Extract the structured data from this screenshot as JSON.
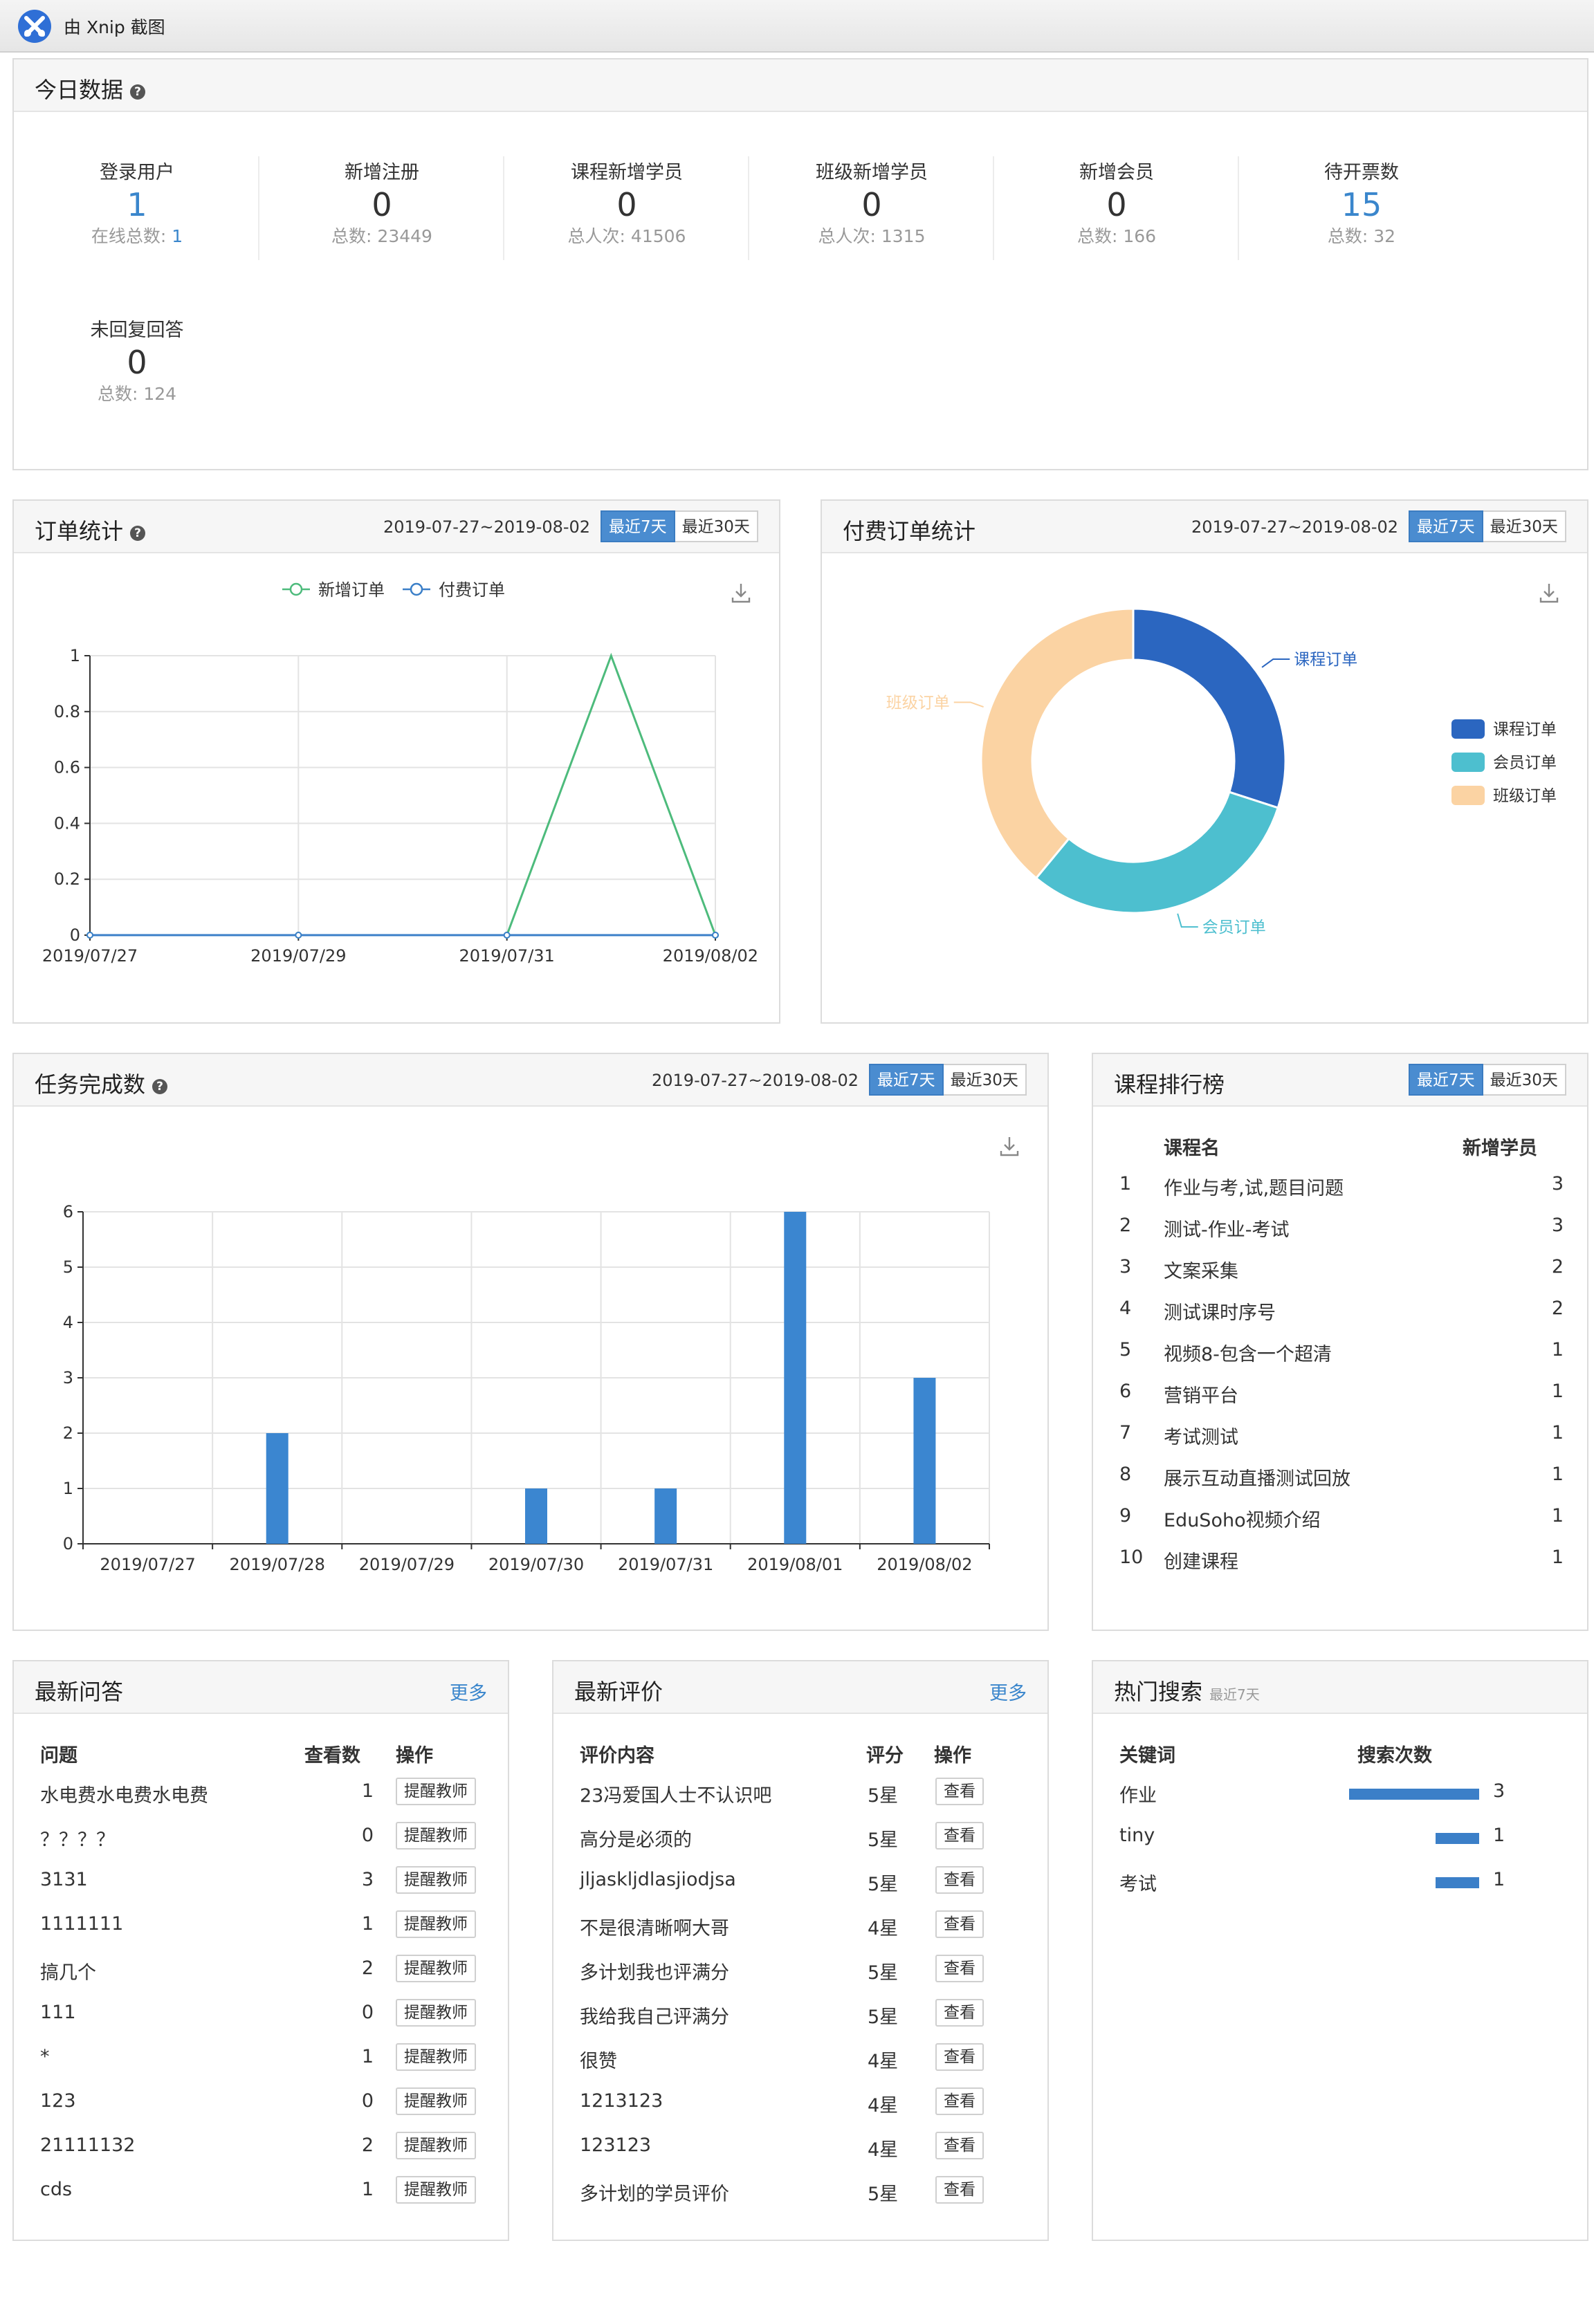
{
  "window": {
    "title": "由 Xnip 截图"
  },
  "today": {
    "title": "今日数据",
    "stats": [
      {
        "label": "登录用户",
        "value": "1",
        "sub_label": "在线总数: ",
        "sub_value": "1",
        "value_color": "#3a86cc"
      },
      {
        "label": "新增注册",
        "value": "0",
        "sub_label": "总数: 23449",
        "sub_value": ""
      },
      {
        "label": "课程新增学员",
        "value": "0",
        "sub_label": "总人次: 41506",
        "sub_value": ""
      },
      {
        "label": "班级新增学员",
        "value": "0",
        "sub_label": "总人次: 1315",
        "sub_value": ""
      },
      {
        "label": "新增会员",
        "value": "0",
        "sub_label": "总数: 166",
        "sub_value": ""
      },
      {
        "label": "待开票数",
        "value": "15",
        "sub_label": "总数: 32",
        "sub_value": "",
        "value_color": "#3a86cc"
      },
      {
        "label": "未回复回答",
        "value": "0",
        "sub_label": "总数: 124",
        "sub_value": ""
      }
    ]
  },
  "orders": {
    "title": "订单统计",
    "range": "2019-07-27~2019-08-02",
    "btn_7": "最近7天",
    "btn_30": "最近30天"
  },
  "paid_orders": {
    "title": "付费订单统计",
    "range": "2019-07-27~2019-08-02",
    "btn_7": "最近7天",
    "btn_30": "最近30天"
  },
  "tasks": {
    "title": "任务完成数",
    "range": "2019-07-27~2019-08-02",
    "btn_7": "最近7天",
    "btn_30": "最近30天"
  },
  "ranking": {
    "title": "课程排行榜",
    "btn_7": "最近7天",
    "btn_30": "最近30天",
    "col_name": "课程名",
    "col_count": "新增学员",
    "rows": [
      {
        "rank": "1",
        "name": "作业与考,试,题目问题",
        "count": "3"
      },
      {
        "rank": "2",
        "name": "测试-作业-考试",
        "count": "3"
      },
      {
        "rank": "3",
        "name": "文案采集",
        "count": "2"
      },
      {
        "rank": "4",
        "name": "测试课时序号",
        "count": "2"
      },
      {
        "rank": "5",
        "name": "视频8-包含一个超清",
        "count": "1"
      },
      {
        "rank": "6",
        "name": "营销平台",
        "count": "1"
      },
      {
        "rank": "7",
        "name": "考试测试",
        "count": "1"
      },
      {
        "rank": "8",
        "name": "展示互动直播测试回放",
        "count": "1"
      },
      {
        "rank": "9",
        "name": "EduSoho视频介绍",
        "count": "1"
      },
      {
        "rank": "10",
        "name": "创建课程",
        "count": "1"
      }
    ]
  },
  "qa": {
    "title": "最新问答",
    "more": "更多",
    "col_question": "问题",
    "col_views": "查看数",
    "col_action": "操作",
    "action_label": "提醒教师",
    "rows": [
      {
        "question": "水电费水电费水电费",
        "views": "1"
      },
      {
        "question": "？？？？",
        "views": "0"
      },
      {
        "question": "3131",
        "views": "3"
      },
      {
        "question": "1111111",
        "views": "1"
      },
      {
        "question": "搞几个",
        "views": "2"
      },
      {
        "question": "111",
        "views": "0"
      },
      {
        "question": "*",
        "views": "1"
      },
      {
        "question": "123",
        "views": "0"
      },
      {
        "question": "21111132",
        "views": "2"
      },
      {
        "question": "cds",
        "views": "1"
      }
    ]
  },
  "reviews": {
    "title": "最新评价",
    "more": "更多",
    "col_content": "评价内容",
    "col_score": "评分",
    "col_action": "操作",
    "action_label": "查看",
    "rows": [
      {
        "content": "23冯爱国人士不认识吧",
        "score": "5星"
      },
      {
        "content": "高分是必须的",
        "score": "5星"
      },
      {
        "content": "jljaskljdlasjiodjsa",
        "score": "5星"
      },
      {
        "content": "不是很清晰啊大哥",
        "score": "4星"
      },
      {
        "content": "多计划我也评满分",
        "score": "5星"
      },
      {
        "content": "我给我自己评满分",
        "score": "5星"
      },
      {
        "content": "很赞",
        "score": "4星"
      },
      {
        "content": "1213123",
        "score": "4星"
      },
      {
        "content": "123123",
        "score": "4星"
      },
      {
        "content": "多计划的学员评价",
        "score": "5星"
      }
    ]
  },
  "hot_search": {
    "title": "热门搜索",
    "subtitle": "最近7天",
    "col_keyword": "关键词",
    "col_count": "搜索次数",
    "rows": [
      {
        "keyword": "作业",
        "count": 3
      },
      {
        "keyword": "tiny",
        "count": 1
      },
      {
        "keyword": "考试",
        "count": 1
      }
    ],
    "bar_color": "#3b7fc8"
  },
  "chart_data": [
    {
      "type": "line",
      "x": [
        "2019/07/27",
        "2019/07/28",
        "2019/07/29",
        "2019/07/30",
        "2019/07/31",
        "2019/08/01",
        "2019/08/02"
      ],
      "x_tick_labels": [
        "2019/07/27",
        "2019/07/29",
        "2019/07/31",
        "2019/08/02"
      ],
      "series": [
        {
          "name": "新增订单",
          "values": [
            0,
            0,
            0,
            0,
            0,
            1,
            0
          ],
          "color": "#4dbb7c"
        },
        {
          "name": "付费订单",
          "values": [
            0,
            0,
            0,
            0,
            0,
            0,
            0
          ],
          "color": "#3b7fc8"
        }
      ],
      "ylim": [
        0,
        1
      ],
      "yticks": [
        "0",
        "0.2",
        "0.4",
        "0.6",
        "0.8",
        "1"
      ],
      "legend": "top",
      "grid": true
    },
    {
      "type": "pie",
      "donut": true,
      "slices": [
        {
          "name": "课程订单",
          "value": 30,
          "color": "#2b66c0"
        },
        {
          "name": "会员订单",
          "value": 31,
          "color": "#4dbfcf"
        },
        {
          "name": "班级订单",
          "value": 39,
          "color": "#fbd3a3"
        }
      ],
      "legend": "right"
    },
    {
      "type": "bar",
      "categories": [
        "2019/07/27",
        "2019/07/28",
        "2019/07/29",
        "2019/07/30",
        "2019/07/31",
        "2019/08/01",
        "2019/08/02"
      ],
      "values": [
        0,
        2,
        0,
        1,
        1,
        6,
        3
      ],
      "ylim": [
        0,
        6
      ],
      "yticks": [
        "0",
        "1",
        "2",
        "3",
        "4",
        "5",
        "6"
      ],
      "color": "#3b86d0",
      "grid": true
    }
  ]
}
